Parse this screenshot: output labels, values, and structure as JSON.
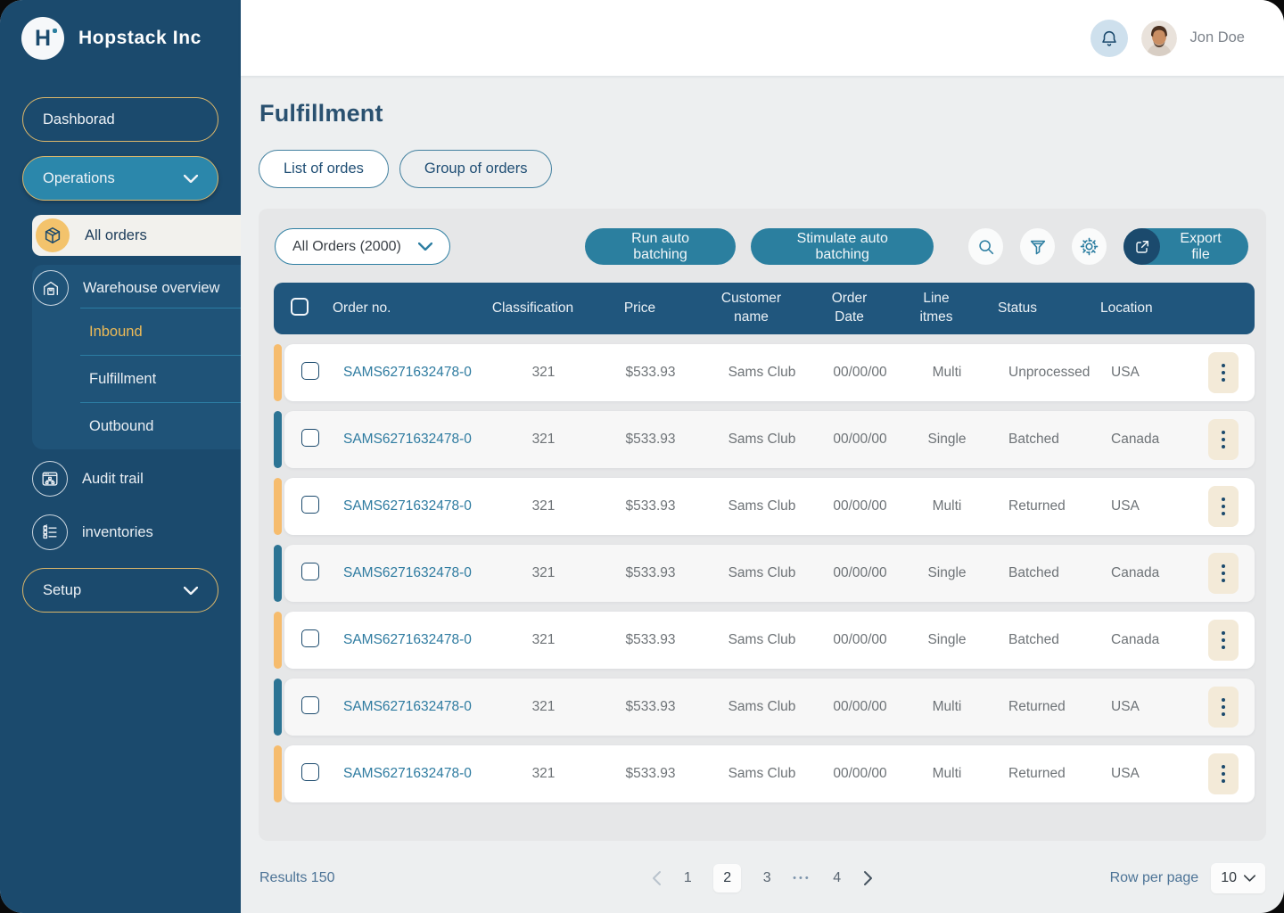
{
  "app": {
    "brand": "Hopstack Inc"
  },
  "colors": {
    "sidebar_bg": "#1B4A6D",
    "teal_button": "#2B7F9F",
    "gold_border": "#DCB76A",
    "accent_orange": "#F6BC6D",
    "accent_blue": "#2C7494",
    "table_header_bg": "#20567D",
    "kebab_bg": "#F3EAD8",
    "inbound_highlight": "#ECBA57"
  },
  "sidebar": {
    "dashboard": "Dashborad",
    "operations": "Operations",
    "all_orders": "All orders",
    "warehouse_overview": "Warehouse overview",
    "inbound": "Inbound",
    "fulfillment": "Fulfillment",
    "outbound": "Outbound",
    "audit_trail": "Audit trail",
    "inventories": "inventories",
    "setup": "Setup"
  },
  "header": {
    "user_name": "Jon Doe"
  },
  "page": {
    "title": "Fulfillment",
    "tabs": {
      "list": "List of ordes",
      "group": "Group of orders"
    }
  },
  "toolbar": {
    "orders_filter": "All Orders (2000)",
    "run_auto_batching": "Run auto batching",
    "stimulate_auto_batching": "Stimulate auto batching",
    "export_file": "Export file"
  },
  "table": {
    "columns": [
      "Order no.",
      "Classification",
      "Price",
      "Customer\nname",
      "Order\nDate",
      "Line\nitmes",
      "Status",
      "Location"
    ],
    "rows": [
      {
        "order_no": "SAMS6271632478-0",
        "classification": "321",
        "price": "$533.93",
        "customer": "Sams Club",
        "date": "00/00/00",
        "line_items": "Multi",
        "status": "Unprocessed",
        "location": "USA",
        "accent": "orange"
      },
      {
        "order_no": "SAMS6271632478-0",
        "classification": "321",
        "price": "$533.93",
        "customer": "Sams Club",
        "date": "00/00/00",
        "line_items": "Single",
        "status": "Batched",
        "location": "Canada",
        "accent": "blue"
      },
      {
        "order_no": "SAMS6271632478-0",
        "classification": "321",
        "price": "$533.93",
        "customer": "Sams Club",
        "date": "00/00/00",
        "line_items": "Multi",
        "status": "Returned",
        "location": "USA",
        "accent": "orange"
      },
      {
        "order_no": "SAMS6271632478-0",
        "classification": "321",
        "price": "$533.93",
        "customer": "Sams Club",
        "date": "00/00/00",
        "line_items": "Single",
        "status": "Batched",
        "location": "Canada",
        "accent": "blue"
      },
      {
        "order_no": "SAMS6271632478-0",
        "classification": "321",
        "price": "$533.93",
        "customer": "Sams Club",
        "date": "00/00/00",
        "line_items": "Single",
        "status": "Batched",
        "location": "Canada",
        "accent": "orange"
      },
      {
        "order_no": "SAMS6271632478-0",
        "classification": "321",
        "price": "$533.93",
        "customer": "Sams Club",
        "date": "00/00/00",
        "line_items": "Multi",
        "status": "Returned",
        "location": "USA",
        "accent": "blue"
      },
      {
        "order_no": "SAMS6271632478-0",
        "classification": "321",
        "price": "$533.93",
        "customer": "Sams Club",
        "date": "00/00/00",
        "line_items": "Multi",
        "status": "Returned",
        "location": "USA",
        "accent": "orange"
      }
    ]
  },
  "footer": {
    "results": "Results 150",
    "pagination": {
      "items": [
        {
          "label": "1",
          "type": "page"
        },
        {
          "label": "2",
          "type": "page",
          "active": true
        },
        {
          "label": "3",
          "type": "page"
        },
        {
          "label": "•••",
          "type": "ellipsis"
        },
        {
          "label": "4",
          "type": "page"
        }
      ]
    },
    "row_per_page_label": "Row per page",
    "row_per_page_value": "10"
  }
}
